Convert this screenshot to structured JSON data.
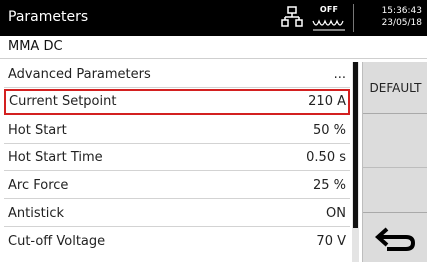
{
  "header": {
    "title": "Parameters",
    "status_off": "OFF",
    "time": "15:36:43",
    "date": "23/05/18",
    "icons": [
      "network-icon",
      "arc-wave-icon"
    ]
  },
  "subheader": {
    "mode": "MMA DC"
  },
  "params": [
    {
      "label": "Advanced Parameters",
      "value": "..."
    },
    {
      "label": "Current Setpoint",
      "value": "210 A",
      "selected": true
    },
    {
      "label": "Hot Start",
      "value": "50 %"
    },
    {
      "label": "Hot Start Time",
      "value": "0.50 s"
    },
    {
      "label": "Arc Force",
      "value": "25 %"
    },
    {
      "label": "Antistick",
      "value": "ON"
    },
    {
      "label": "Cut-off Voltage",
      "value": "70 V"
    }
  ],
  "side": {
    "default_label": "DEFAULT",
    "back_icon": "return-arrow-icon"
  },
  "colors": {
    "header_bg": "#000000",
    "selection_border": "#d32020",
    "panel_bg": "#dcdcdc"
  }
}
